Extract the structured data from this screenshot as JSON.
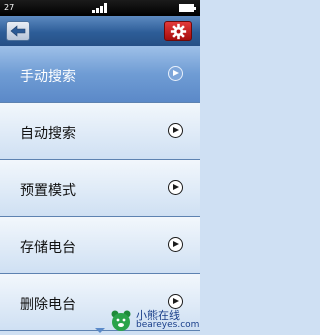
{
  "status_bar": {
    "left_text": "27"
  },
  "menu": {
    "items": [
      {
        "label": "手动搜索",
        "selected": true
      },
      {
        "label": "自动搜索",
        "selected": false
      },
      {
        "label": "预置模式",
        "selected": false
      },
      {
        "label": "存储电台",
        "selected": false
      },
      {
        "label": "删除电台",
        "selected": false
      }
    ]
  },
  "watermark": {
    "cn": "小熊在线",
    "en": "beareyes.com"
  },
  "colors": {
    "title_bar": "#2d5d98",
    "selected_row": "#6f9cd4",
    "settings_button": "#c81f1f"
  },
  "icons": {
    "back": "arrow-left-icon",
    "settings": "gear-icon",
    "row": "play-circle-icon"
  }
}
